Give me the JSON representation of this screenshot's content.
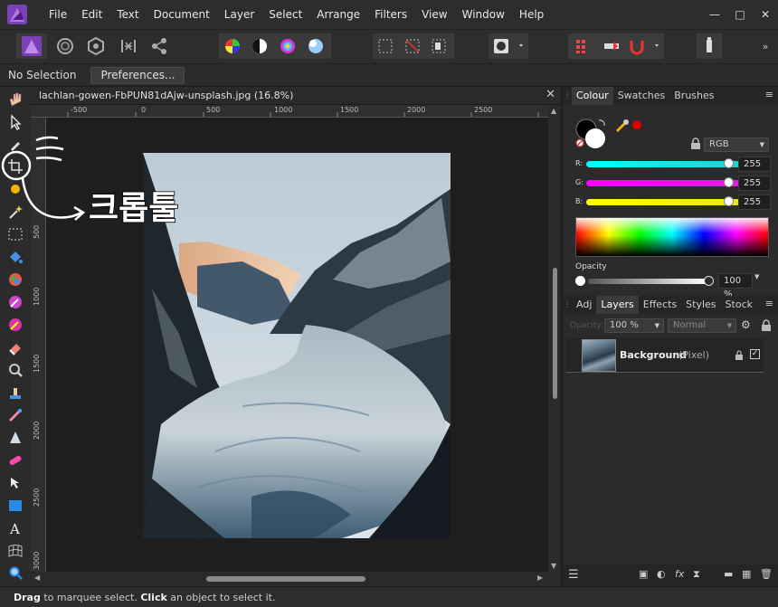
{
  "menu": [
    "File",
    "Edit",
    "Text",
    "Document",
    "Layer",
    "Select",
    "Arrange",
    "Filters",
    "View",
    "Window",
    "Help"
  ],
  "window_controls": [
    "minimize",
    "restore",
    "close"
  ],
  "context": {
    "selection": "No Selection",
    "preferences": "Preferences..."
  },
  "document": {
    "tab_title": "lachlan-gowen-FbPUN81dAjw-unsplash.jpg (16.8%)"
  },
  "ruler_top": [
    "-500",
    "0",
    "500",
    "1000",
    "1500",
    "2000",
    "2500"
  ],
  "ruler_left": [
    "500",
    "1000",
    "1500",
    "2000",
    "2500",
    "3000"
  ],
  "annotation": {
    "text": "크롭툴"
  },
  "colour_panel": {
    "tabs": [
      "Colour",
      "Swatches",
      "Brushes"
    ],
    "model": "RGB",
    "channels": [
      {
        "label": "R:",
        "value": "255"
      },
      {
        "label": "G:",
        "value": "255"
      },
      {
        "label": "B:",
        "value": "255"
      }
    ],
    "opacity_label": "Opacity",
    "opacity_value": "100 %"
  },
  "layers_panel": {
    "tabs": [
      "Adj",
      "Layers",
      "Effects",
      "Styles",
      "Stock"
    ],
    "opacity_label": "Opacity:",
    "opacity_value": "100 %",
    "blend_mode": "Normal",
    "layers": [
      {
        "name": "Background",
        "type": "(Pixel)"
      }
    ]
  },
  "status": {
    "drag": "Drag",
    "drag_text": " to marquee select. ",
    "click": "Click",
    "click_text": " an object to select it."
  },
  "colors": {
    "accent": "#1a9ee8",
    "r_slider": "#18d4d4",
    "g_slider": "#e01ee0",
    "b_slider": "#e8e818",
    "fg_colour": "#000000",
    "bg_colour": "#ffffff"
  }
}
